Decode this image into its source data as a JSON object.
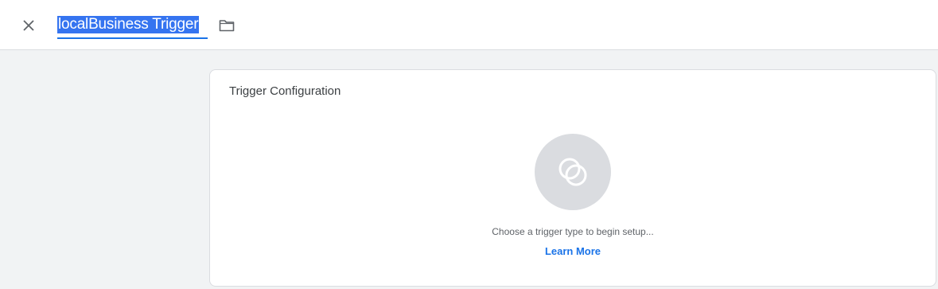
{
  "header": {
    "close_icon": "close-icon",
    "trigger_name": "localBusiness Trigger",
    "folder_icon": "folder-icon",
    "accent_color": "#1a73e8"
  },
  "card": {
    "title": "Trigger Configuration",
    "trigger_type_icon": "trigger-type-icon",
    "hint": "Choose a trigger type to begin setup...",
    "learn_more_label": "Learn More"
  }
}
